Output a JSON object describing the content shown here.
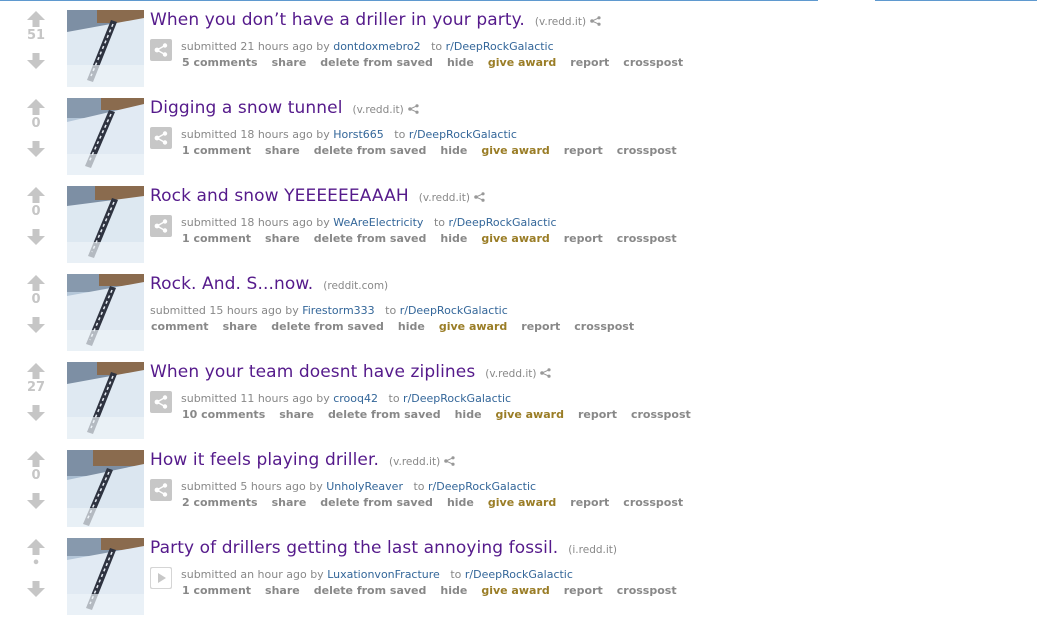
{
  "colors": {
    "title_visited": "#551a8b",
    "link": "#336699",
    "muted": "#888888",
    "award": "#9a7d26",
    "arrow": "#c6c6c6",
    "border": "#5f99cf"
  },
  "icons": {
    "upvote": "arrow-up-icon",
    "downvote": "arrow-down-icon",
    "share": "share-icon",
    "expando_link": "share-icon",
    "expando_video": "play-icon"
  },
  "labels": {
    "submitted_prefix": "submitted",
    "by": "by",
    "to": "to",
    "share": "share",
    "delete": "delete from saved",
    "hide": "hide",
    "award": "give award",
    "report": "report",
    "crosspost": "crosspost"
  },
  "posts": [
    {
      "title": "When you don’t have a driller in your party.",
      "domain": "(v.redd.it)",
      "score": "51",
      "time": "21 hours ago",
      "user": "dontdoxmebro2",
      "sub": "r/DeepRockGalactic",
      "comments": "5 comments"
    },
    {
      "title": "Digging a snow tunnel",
      "domain": "(v.redd.it)",
      "score": "0",
      "time": "18 hours ago",
      "user": "Horst665",
      "sub": "r/DeepRockGalactic",
      "comments": "1 comment"
    },
    {
      "title": "Rock and snow YEEEEEEAAAH",
      "domain": "(v.redd.it)",
      "score": "0",
      "time": "18 hours ago",
      "user": "WeAreElectricity",
      "sub": "r/DeepRockGalactic",
      "comments": "1 comment"
    },
    {
      "title": "Rock. And. S...now.",
      "domain": "(reddit.com)",
      "score": "0",
      "time": "15 hours ago",
      "user": "Firestorm333",
      "sub": "r/DeepRockGalactic",
      "comments": "comment"
    },
    {
      "title": "When your team doesnt have ziplines",
      "domain": "(v.redd.it)",
      "score": "27",
      "time": "11 hours ago",
      "user": "crooq42",
      "sub": "r/DeepRockGalactic",
      "comments": "10 comments"
    },
    {
      "title": "How it feels playing driller.",
      "domain": "(v.redd.it)",
      "score": "0",
      "time": "5 hours ago",
      "user": "UnholyReaver",
      "sub": "r/DeepRockGalactic",
      "comments": "2 comments"
    },
    {
      "title": "Party of drillers getting the last annoying fossil.",
      "domain": "(i.redd.it)",
      "score": "•",
      "time": "an hour ago",
      "user": "LuxationvonFracture",
      "sub": "r/DeepRockGalactic",
      "comments": "1 comment"
    }
  ]
}
